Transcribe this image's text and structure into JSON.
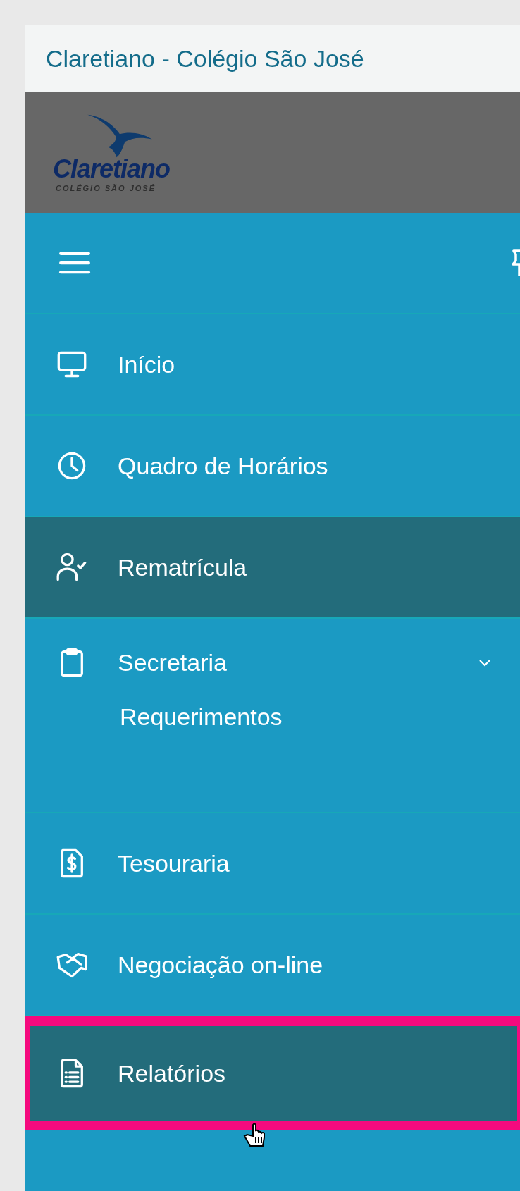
{
  "header": {
    "title": "Claretiano - Colégio São José"
  },
  "logo": {
    "name": "Claretiano",
    "subtitle": "COLÉGIO SÃO JOSÉ"
  },
  "menu": [
    {
      "label": "Início",
      "selected": false,
      "highlighted": false
    },
    {
      "label": "Quadro de Horários",
      "selected": false,
      "highlighted": false
    },
    {
      "label": "Rematrícula",
      "selected": true,
      "highlighted": false
    },
    {
      "label": "Secretaria",
      "selected": false,
      "highlighted": false,
      "expanded": true,
      "children": [
        {
          "label": "Requerimentos"
        }
      ]
    },
    {
      "label": "Tesouraria",
      "selected": false,
      "highlighted": false
    },
    {
      "label": "Negociação on-line",
      "selected": false,
      "highlighted": false
    },
    {
      "label": "Relatórios",
      "selected": true,
      "highlighted": true
    }
  ]
}
